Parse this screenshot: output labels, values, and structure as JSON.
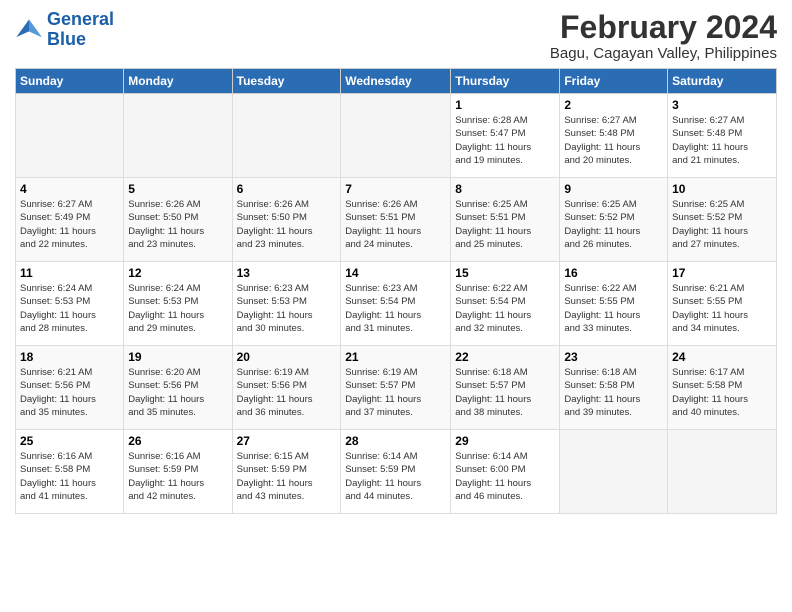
{
  "logo": {
    "line1": "General",
    "line2": "Blue"
  },
  "title": "February 2024",
  "subtitle": "Bagu, Cagayan Valley, Philippines",
  "headers": [
    "Sunday",
    "Monday",
    "Tuesday",
    "Wednesday",
    "Thursday",
    "Friday",
    "Saturday"
  ],
  "weeks": [
    [
      {
        "day": "",
        "info": ""
      },
      {
        "day": "",
        "info": ""
      },
      {
        "day": "",
        "info": ""
      },
      {
        "day": "",
        "info": ""
      },
      {
        "day": "1",
        "info": "Sunrise: 6:28 AM\nSunset: 5:47 PM\nDaylight: 11 hours\nand 19 minutes."
      },
      {
        "day": "2",
        "info": "Sunrise: 6:27 AM\nSunset: 5:48 PM\nDaylight: 11 hours\nand 20 minutes."
      },
      {
        "day": "3",
        "info": "Sunrise: 6:27 AM\nSunset: 5:48 PM\nDaylight: 11 hours\nand 21 minutes."
      }
    ],
    [
      {
        "day": "4",
        "info": "Sunrise: 6:27 AM\nSunset: 5:49 PM\nDaylight: 11 hours\nand 22 minutes."
      },
      {
        "day": "5",
        "info": "Sunrise: 6:26 AM\nSunset: 5:50 PM\nDaylight: 11 hours\nand 23 minutes."
      },
      {
        "day": "6",
        "info": "Sunrise: 6:26 AM\nSunset: 5:50 PM\nDaylight: 11 hours\nand 23 minutes."
      },
      {
        "day": "7",
        "info": "Sunrise: 6:26 AM\nSunset: 5:51 PM\nDaylight: 11 hours\nand 24 minutes."
      },
      {
        "day": "8",
        "info": "Sunrise: 6:25 AM\nSunset: 5:51 PM\nDaylight: 11 hours\nand 25 minutes."
      },
      {
        "day": "9",
        "info": "Sunrise: 6:25 AM\nSunset: 5:52 PM\nDaylight: 11 hours\nand 26 minutes."
      },
      {
        "day": "10",
        "info": "Sunrise: 6:25 AM\nSunset: 5:52 PM\nDaylight: 11 hours\nand 27 minutes."
      }
    ],
    [
      {
        "day": "11",
        "info": "Sunrise: 6:24 AM\nSunset: 5:53 PM\nDaylight: 11 hours\nand 28 minutes."
      },
      {
        "day": "12",
        "info": "Sunrise: 6:24 AM\nSunset: 5:53 PM\nDaylight: 11 hours\nand 29 minutes."
      },
      {
        "day": "13",
        "info": "Sunrise: 6:23 AM\nSunset: 5:53 PM\nDaylight: 11 hours\nand 30 minutes."
      },
      {
        "day": "14",
        "info": "Sunrise: 6:23 AM\nSunset: 5:54 PM\nDaylight: 11 hours\nand 31 minutes."
      },
      {
        "day": "15",
        "info": "Sunrise: 6:22 AM\nSunset: 5:54 PM\nDaylight: 11 hours\nand 32 minutes."
      },
      {
        "day": "16",
        "info": "Sunrise: 6:22 AM\nSunset: 5:55 PM\nDaylight: 11 hours\nand 33 minutes."
      },
      {
        "day": "17",
        "info": "Sunrise: 6:21 AM\nSunset: 5:55 PM\nDaylight: 11 hours\nand 34 minutes."
      }
    ],
    [
      {
        "day": "18",
        "info": "Sunrise: 6:21 AM\nSunset: 5:56 PM\nDaylight: 11 hours\nand 35 minutes."
      },
      {
        "day": "19",
        "info": "Sunrise: 6:20 AM\nSunset: 5:56 PM\nDaylight: 11 hours\nand 35 minutes."
      },
      {
        "day": "20",
        "info": "Sunrise: 6:19 AM\nSunset: 5:56 PM\nDaylight: 11 hours\nand 36 minutes."
      },
      {
        "day": "21",
        "info": "Sunrise: 6:19 AM\nSunset: 5:57 PM\nDaylight: 11 hours\nand 37 minutes."
      },
      {
        "day": "22",
        "info": "Sunrise: 6:18 AM\nSunset: 5:57 PM\nDaylight: 11 hours\nand 38 minutes."
      },
      {
        "day": "23",
        "info": "Sunrise: 6:18 AM\nSunset: 5:58 PM\nDaylight: 11 hours\nand 39 minutes."
      },
      {
        "day": "24",
        "info": "Sunrise: 6:17 AM\nSunset: 5:58 PM\nDaylight: 11 hours\nand 40 minutes."
      }
    ],
    [
      {
        "day": "25",
        "info": "Sunrise: 6:16 AM\nSunset: 5:58 PM\nDaylight: 11 hours\nand 41 minutes."
      },
      {
        "day": "26",
        "info": "Sunrise: 6:16 AM\nSunset: 5:59 PM\nDaylight: 11 hours\nand 42 minutes."
      },
      {
        "day": "27",
        "info": "Sunrise: 6:15 AM\nSunset: 5:59 PM\nDaylight: 11 hours\nand 43 minutes."
      },
      {
        "day": "28",
        "info": "Sunrise: 6:14 AM\nSunset: 5:59 PM\nDaylight: 11 hours\nand 44 minutes."
      },
      {
        "day": "29",
        "info": "Sunrise: 6:14 AM\nSunset: 6:00 PM\nDaylight: 11 hours\nand 46 minutes."
      },
      {
        "day": "",
        "info": ""
      },
      {
        "day": "",
        "info": ""
      }
    ]
  ]
}
